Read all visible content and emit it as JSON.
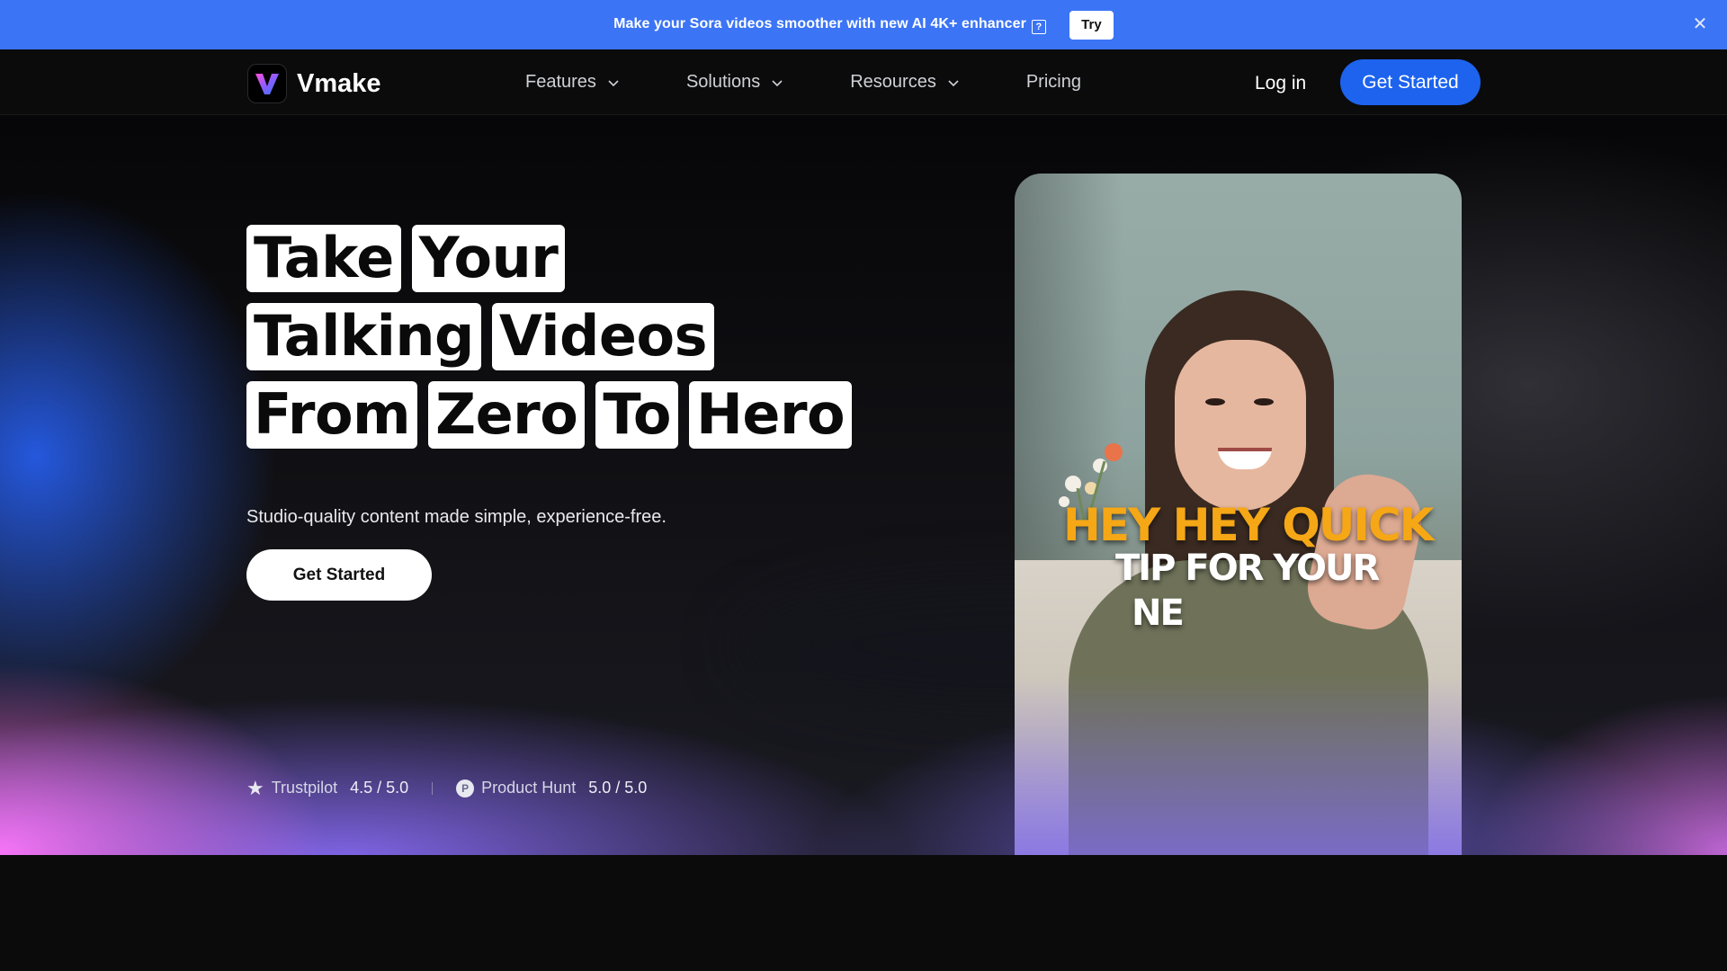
{
  "announcement": {
    "text": "Make your Sora videos smoother with new AI 4K+ enhancer",
    "help_glyph": "?",
    "try_label": "Try",
    "close_glyph": "✕",
    "color": "#3b74f5"
  },
  "nav": {
    "brand": "Vmake",
    "items": [
      {
        "label": "Features",
        "has_dropdown": true
      },
      {
        "label": "Solutions",
        "has_dropdown": true
      },
      {
        "label": "Resources",
        "has_dropdown": true
      },
      {
        "label": "Pricing",
        "has_dropdown": false
      }
    ],
    "login_label": "Log in",
    "cta_label": "Get Started",
    "accent": "#1d63ee"
  },
  "hero": {
    "headline_rows": [
      [
        "Take",
        "Your"
      ],
      [
        "Talking",
        "Videos"
      ],
      [
        "From",
        "Zero",
        "To",
        "Hero"
      ]
    ],
    "subtitle": "Studio-quality content made simple, experience-free.",
    "cta_label": "Get Started",
    "ratings": [
      {
        "icon": "star-icon",
        "source": "Trustpilot",
        "score": "4.5 / 5.0"
      },
      {
        "icon": "product-hunt-icon",
        "source": "Product Hunt",
        "score": "5.0 / 5.0",
        "glyph": "P"
      }
    ],
    "video_captions": [
      "HEY HEY QUICK",
      "TIP FOR YOUR",
      "NE"
    ]
  }
}
